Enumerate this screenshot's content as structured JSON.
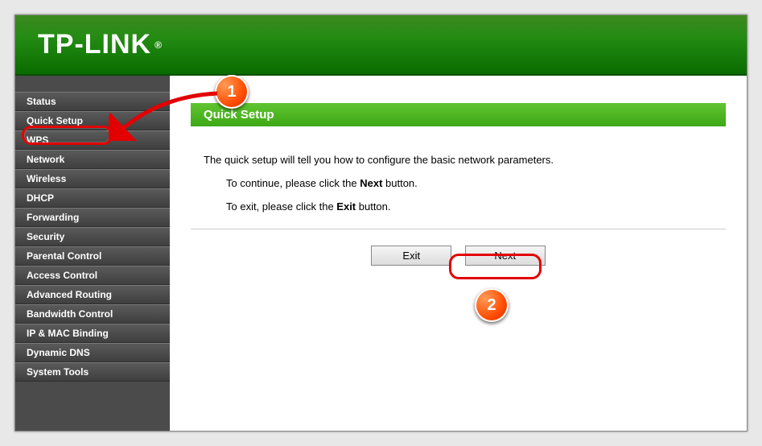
{
  "brand": "TP-LINK",
  "sidebar": {
    "items": [
      {
        "label": "Status"
      },
      {
        "label": "Quick Setup"
      },
      {
        "label": "WPS"
      },
      {
        "label": "Network"
      },
      {
        "label": "Wireless"
      },
      {
        "label": "DHCP"
      },
      {
        "label": "Forwarding"
      },
      {
        "label": "Security"
      },
      {
        "label": "Parental Control"
      },
      {
        "label": "Access Control"
      },
      {
        "label": "Advanced Routing"
      },
      {
        "label": "Bandwidth Control"
      },
      {
        "label": "IP & MAC Binding"
      },
      {
        "label": "Dynamic DNS"
      },
      {
        "label": "System Tools"
      }
    ]
  },
  "page": {
    "title": "Quick Setup",
    "intro": "The quick setup will tell you how to configure the basic network parameters.",
    "line_continue_pre": "To continue, please click the ",
    "line_continue_bold": "Next",
    "line_continue_post": " button.",
    "line_exit_pre": "To exit, please click the ",
    "line_exit_bold": "Exit",
    "line_exit_post": " button.",
    "btn_exit": "Exit",
    "btn_next": "Next"
  },
  "annotations": {
    "badge1": "1",
    "badge2": "2"
  }
}
